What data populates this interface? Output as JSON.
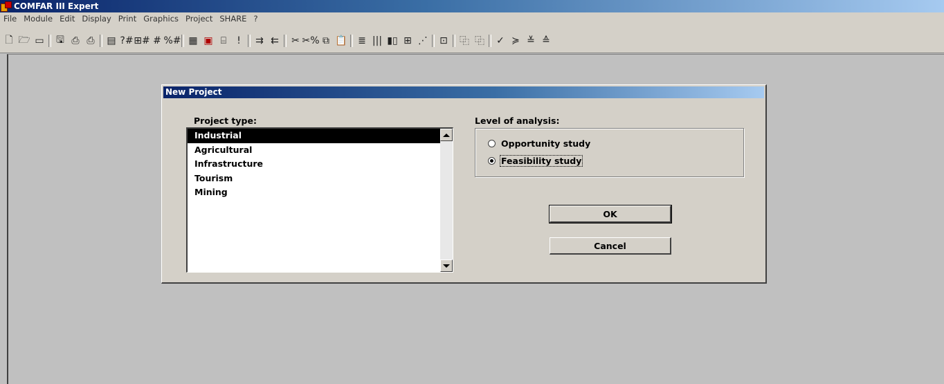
{
  "app": {
    "title": "COMFAR III Expert"
  },
  "menu": [
    "File",
    "Module",
    "Edit",
    "Display",
    "Print",
    "Graphics",
    "Project",
    "SHARE",
    "?"
  ],
  "toolbar": {
    "groups": [
      [
        {
          "name": "new-file-icon",
          "glyph": "🗋"
        },
        {
          "name": "open-folder-icon",
          "glyph": "🗁"
        },
        {
          "name": "blank-window-icon",
          "glyph": "▭"
        }
      ],
      [
        {
          "name": "save-icon",
          "glyph": "🖫"
        },
        {
          "name": "print-icon",
          "glyph": "⎙"
        },
        {
          "name": "print-preview-icon",
          "glyph": "⎙"
        }
      ],
      [
        {
          "name": "table-view-icon",
          "glyph": "▤"
        },
        {
          "name": "help-hash-icon",
          "glyph": "?#"
        },
        {
          "name": "grid-hash-icon",
          "glyph": "⊞#"
        },
        {
          "name": "hash-icon",
          "glyph": "#"
        },
        {
          "name": "percent-hash-icon",
          "glyph": "%#"
        }
      ],
      [
        {
          "name": "grid-icon",
          "glyph": "▦"
        },
        {
          "name": "calculator-icon",
          "glyph": "▣",
          "red": true
        },
        {
          "name": "chart-edit-icon",
          "glyph": "⌸"
        },
        {
          "name": "exclamation-icon",
          "glyph": "!"
        }
      ],
      [
        {
          "name": "flow-right-icon",
          "glyph": "⇉"
        },
        {
          "name": "flow-left-icon",
          "glyph": "⇇"
        }
      ],
      [
        {
          "name": "cut-icon",
          "glyph": "✂"
        },
        {
          "name": "cut-percent-icon",
          "glyph": "✂%"
        },
        {
          "name": "copy-icon",
          "glyph": "⧉"
        },
        {
          "name": "paste-icon",
          "glyph": "📋"
        }
      ],
      [
        {
          "name": "rows-icon",
          "glyph": "≣"
        },
        {
          "name": "columns-icon",
          "glyph": "|||"
        },
        {
          "name": "bar-chart-icon",
          "glyph": "▮▯"
        },
        {
          "name": "matrix-icon",
          "glyph": "⊞"
        },
        {
          "name": "slope-icon",
          "glyph": "⋰"
        }
      ],
      [
        {
          "name": "link-hash-icon",
          "glyph": "⊡"
        }
      ],
      [
        {
          "name": "copy-table-icon",
          "glyph": "⿻"
        },
        {
          "name": "paste-table-icon",
          "glyph": "⿻"
        }
      ],
      [
        {
          "name": "check-icon",
          "glyph": "✓"
        },
        {
          "name": "check-up-icon",
          "glyph": "≽"
        },
        {
          "name": "check-down-icon",
          "glyph": "≚"
        },
        {
          "name": "check-all-icon",
          "glyph": "≙"
        }
      ]
    ]
  },
  "dialog": {
    "title": "New Project",
    "project_type_label": "Project type:",
    "project_types": [
      "Industrial",
      "Agricultural",
      "Infrastructure",
      "Tourism",
      "Mining"
    ],
    "selected_project_type": "Industrial",
    "level_label": "Level of analysis:",
    "levels": [
      "Opportunity study",
      "Feasibility study"
    ],
    "selected_level": "Feasibility study",
    "ok_label": "OK",
    "cancel_label": "Cancel"
  }
}
